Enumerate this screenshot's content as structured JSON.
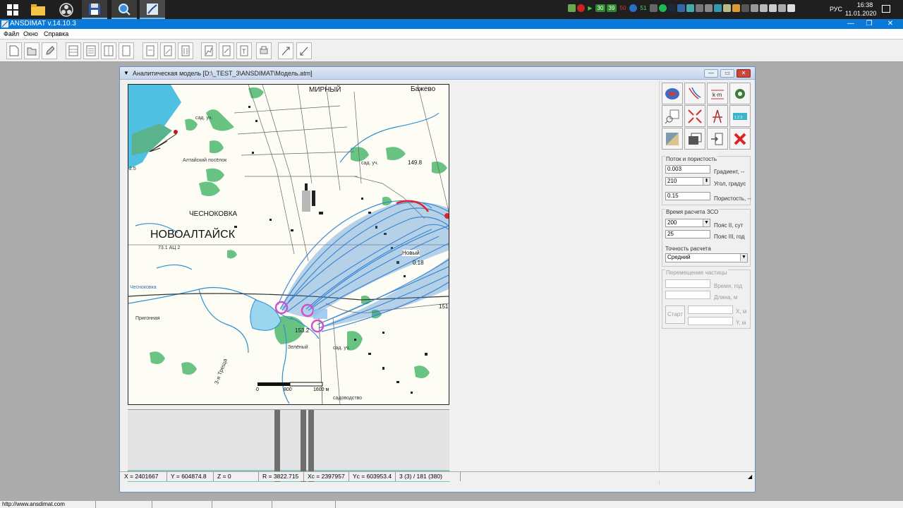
{
  "taskbar": {
    "apps": [
      "windows-start",
      "file-explorer",
      "obs-studio",
      "save-disk",
      "magnifier-app",
      "ansdimat-app"
    ],
    "lang": "РУС",
    "time": "16:38",
    "date": "11.01.2020",
    "tray_numbers": [
      "30",
      "39",
      "50",
      "51"
    ]
  },
  "app": {
    "title": "ANSDIMAT v.14.10.3",
    "menu": [
      "Файл",
      "Окно",
      "Справка"
    ]
  },
  "child": {
    "title": "Аналитическая модель  [D:\\_TEST_3\\ANSDIMAT\\Модель.atm]"
  },
  "map": {
    "labels": {
      "mirny": "МИРНЫЙ",
      "bazhevo": "Бажево",
      "chesnokovka": "ЧЕСНОКОВКА",
      "novoaltaysk": "НОВОАЛТАЙСК",
      "altaysky_poselok": "Алтайский посёлок",
      "sad_uch_1": "сад. уч.",
      "sad_uch_2": "сад. уч.",
      "sad_uch_3": "сад. уч.",
      "novy": "Новый",
      "val_149": "149.8",
      "val_153": "153.2",
      "val_151": "151",
      "val_018": "0.18",
      "val_731": "73.1  АЦ 2",
      "val_25": "2.5",
      "prigonnaya": "Пригонная",
      "chesnokovka_river": "Чесноковка",
      "zelyony": "Зелёный",
      "tretya": "3-я Треща",
      "sad_small": "садоводство"
    },
    "scale": {
      "zero": "0",
      "mid": "800",
      "end": "1600 м"
    }
  },
  "panel": {
    "flow": {
      "title": "Поток и пористость",
      "gradient_value": "0.003",
      "gradient_label": "Градиент, --",
      "angle_value": "210",
      "angle_label": "Угол, градус",
      "porosity_value": "0.15",
      "porosity_label": "Пористость, --"
    },
    "zso": {
      "title": "Время расчета ЗСО",
      "belt2_value": "200",
      "belt2_label": "Пояс II, сут",
      "belt3_value": "25",
      "belt3_label": "Пояс III, год",
      "accuracy_title": "Точность расчета",
      "accuracy_value": "Средний"
    },
    "particle": {
      "title": "Перемещение частицы",
      "time_label": "Время, год",
      "length_label": "Длина, м",
      "start_label": "Старт",
      "x_label": "X, м",
      "y_label": "Y, м"
    }
  },
  "status": {
    "x": "X = 2401667",
    "y": "Y = 604874.8",
    "z": "Z = 0",
    "r": "R = 3822.715",
    "xc": "Xc = 2397957",
    "yc": "Yc = 603953.4",
    "count": "3 (3) / 181 (380)"
  },
  "os_status": {
    "url": "http://www.ansdimat.com"
  },
  "colors": {
    "titlebar": "#0a78d7",
    "flow_lines": "#2e7fd1",
    "capture_edge": "#e0222a",
    "well": "#d050d0",
    "aquifer": "#8ff3f6"
  },
  "icons": {
    "toolbar": [
      "new-doc-icon",
      "open-folder-icon",
      "edit-icon",
      "table-icon",
      "list-icon",
      "grid-icon",
      "doc-icon",
      "doc-alt-icon",
      "page-icon",
      "graph-icon",
      "columns-icon",
      "export-icon",
      "chart-icon",
      "text-icon",
      "print-icon",
      "expand-icon",
      "shrink-icon"
    ],
    "panel": [
      "map-wells-icon",
      "streamlines-icon",
      "k-m-icon",
      "settings-icon",
      "zoom-icon",
      "shrink-arrows-icon",
      "wells-tower-icon",
      "ruler-icon",
      "surface-icon",
      "layers-icon",
      "import-icon",
      "delete-icon"
    ]
  }
}
